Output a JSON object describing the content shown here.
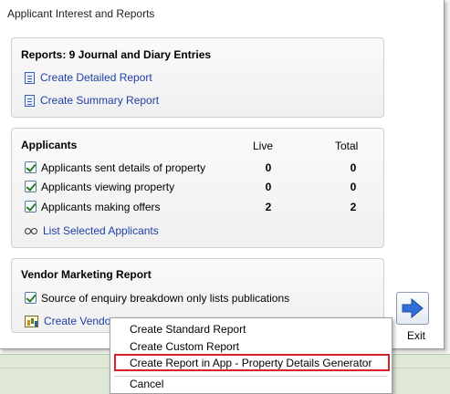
{
  "window": {
    "title": "Applicant Interest and Reports"
  },
  "reports": {
    "heading": "Reports: 9 Journal and Diary Entries",
    "links": [
      {
        "label": "Create Detailed Report",
        "icon": "document-icon"
      },
      {
        "label": "Create Summary Report",
        "icon": "document-icon"
      }
    ]
  },
  "applicants": {
    "heading": "Applicants",
    "col_live": "Live",
    "col_total": "Total",
    "rows": [
      {
        "label": "Applicants sent details of property",
        "checked": true,
        "live": "0",
        "total": "0"
      },
      {
        "label": "Applicants viewing property",
        "checked": true,
        "live": "0",
        "total": "0"
      },
      {
        "label": "Applicants making offers",
        "checked": true,
        "live": "2",
        "total": "2"
      }
    ],
    "list_link": "List Selected Applicants"
  },
  "vendor": {
    "heading": "Vendor Marketing Report",
    "checkbox_label": "Source of enquiry breakdown only lists publications",
    "checked": true,
    "link": "Create Vendor"
  },
  "exit": {
    "label": "Exit"
  },
  "context_menu": {
    "items": [
      "Create Standard Report",
      "Create Custom Report",
      "Create Report in App - Property Details Generator",
      "Cancel"
    ],
    "highlighted_index": 2
  },
  "colors": {
    "link": "#1f3fa8",
    "highlight_border": "#d6232a",
    "exit_arrow": "#2f6fd6"
  }
}
